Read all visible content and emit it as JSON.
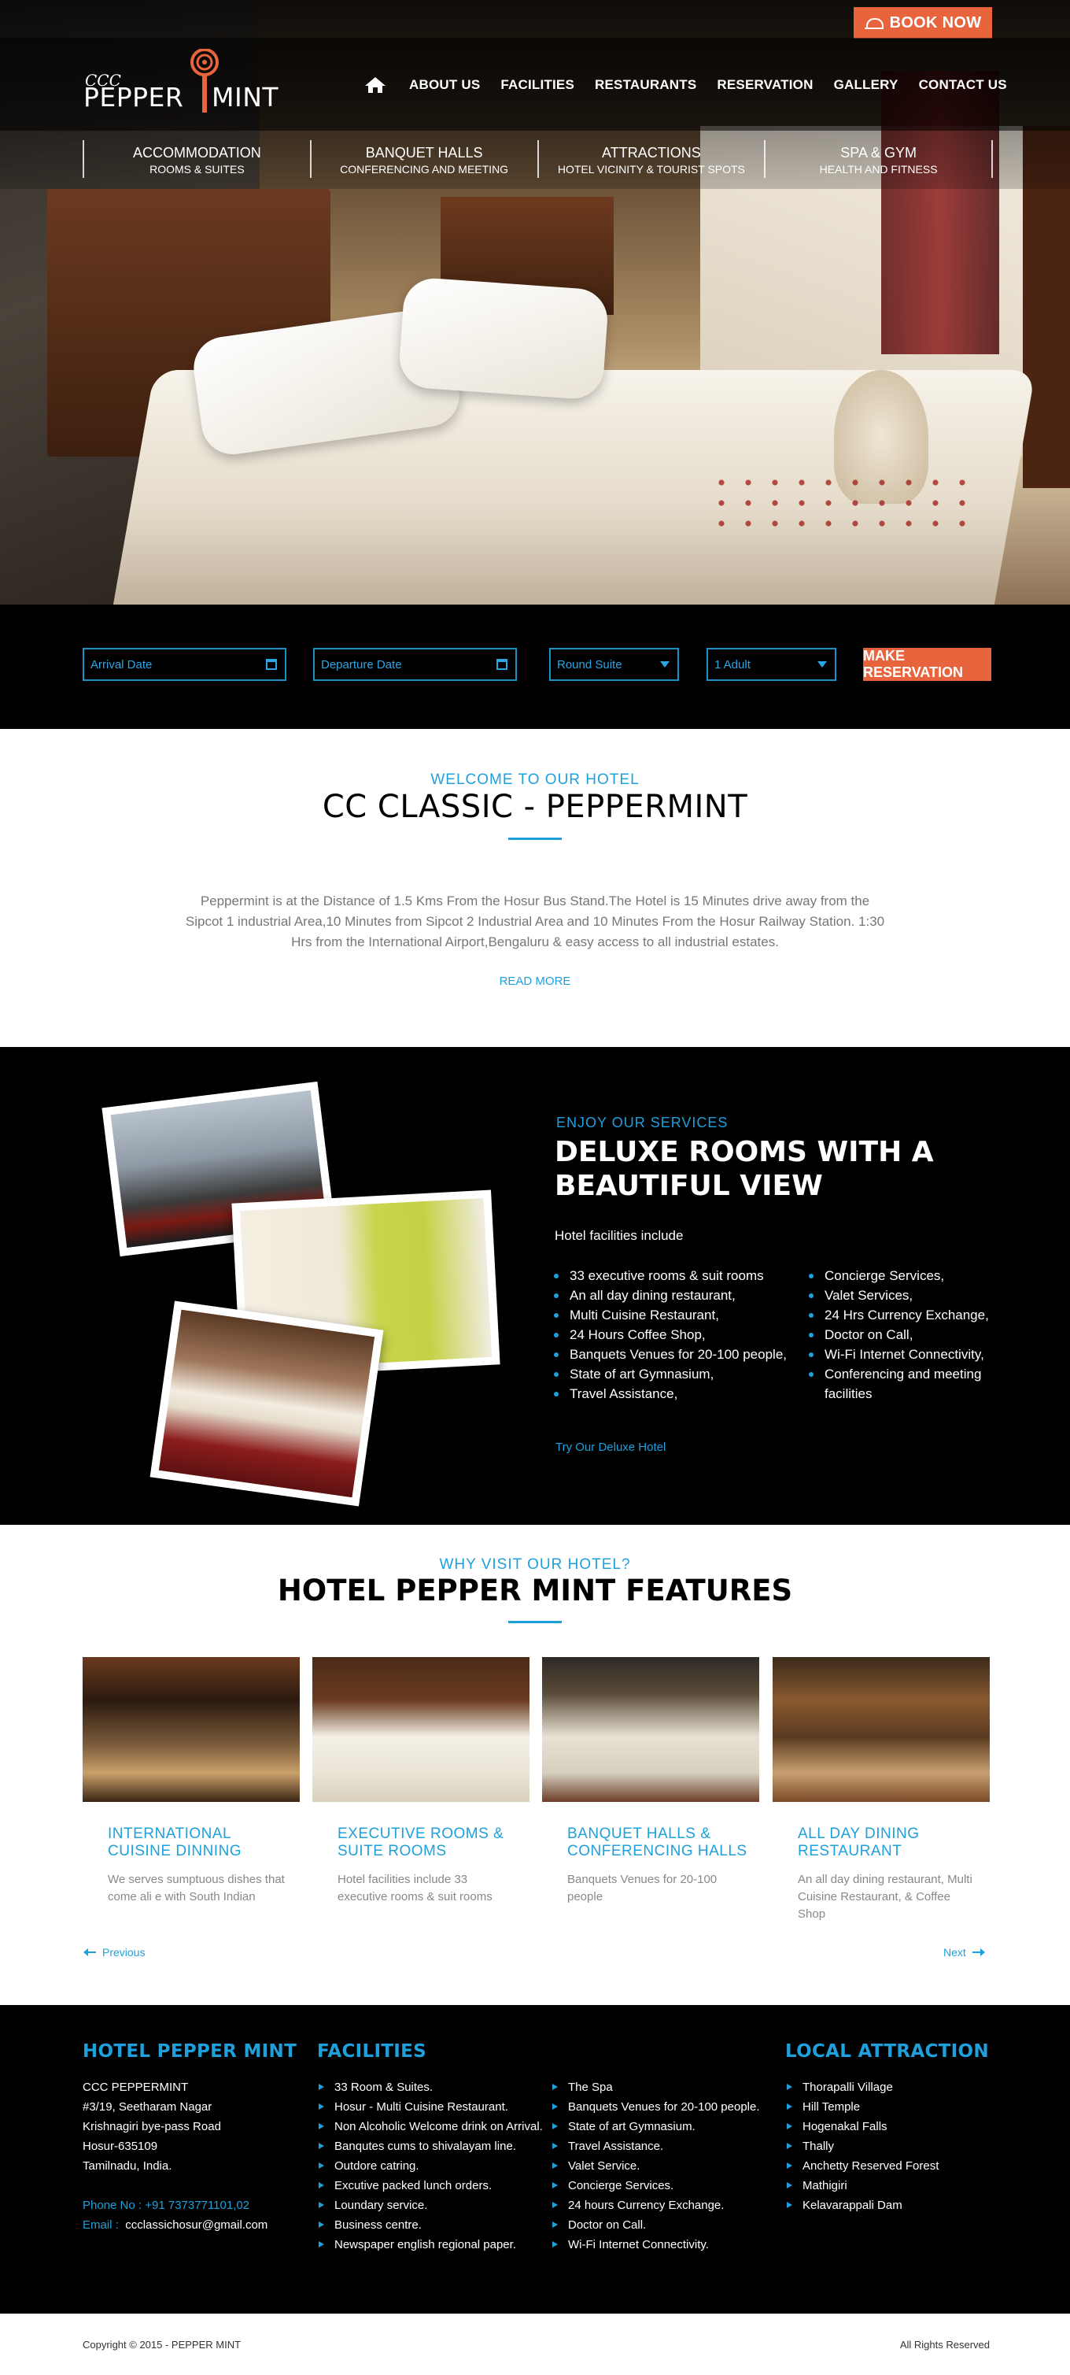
{
  "header": {
    "book_now": "BOOK NOW",
    "logo_ccc": "CCC",
    "logo_pepper": "PEPPER",
    "logo_mint": "MINT",
    "nav": [
      "ABOUT US",
      "FACILITIES",
      "RESTAURANTS",
      "RESERVATION",
      "GALLERY",
      "CONTACT US"
    ],
    "subnav": [
      {
        "title": "ACCOMMODATION",
        "sub": "ROOMS & SUITES"
      },
      {
        "title": "BANQUET HALLS",
        "sub": "CONFERENCING AND MEETING"
      },
      {
        "title": "ATTRACTIONS",
        "sub": "HOTEL VICINITY & TOURIST SPOTS"
      },
      {
        "title": "SPA & GYM",
        "sub": "HEALTH AND FITNESS"
      }
    ]
  },
  "reservation": {
    "arrival": "Arrival Date",
    "departure": "Departure Date",
    "room": "Round Suite",
    "adults": "1 Adult",
    "submit": "MAKE RESERVATION"
  },
  "welcome": {
    "eyebrow": "WELCOME TO OUR HOTEL",
    "title": "CC CLASSIC - PEPPERMINT",
    "body": "Peppermint is at the Distance of 1.5 Kms From the Hosur Bus Stand.The Hotel is 15 Minutes drive away from the Sipcot 1 industrial Area,10 Minutes from Sipcot 2 Industrial Area and 10 Minutes From the Hosur Railway Station. 1:30 Hrs from the International Airport,Bengaluru & easy access to all industrial estates.",
    "read_more": "READ MORE"
  },
  "services": {
    "eyebrow": "ENJOY OUR SERVICES",
    "title": "DELUXE ROOMS WITH A BEAUTIFUL VIEW",
    "intro": "Hotel facilities include",
    "list_left": [
      "33 executive rooms & suit rooms",
      "An all day dining restaurant,",
      "Multi Cuisine Restaurant,",
      "24 Hours Coffee Shop,",
      "Banquets Venues for 20-100 people,",
      "State of art Gymnasium,",
      "Travel Assistance,"
    ],
    "list_right": [
      "Concierge Services,",
      "Valet Services,",
      "24 Hrs Currency Exchange,",
      "Doctor on Call,",
      "Wi-Fi Internet Connectivity,",
      "Conferencing and meeting facilities"
    ],
    "link": "Try Our Deluxe Hotel"
  },
  "features": {
    "eyebrow": "WHY VISIT OUR HOTEL?",
    "title": "HOTEL PEPPER MINT FEATURES",
    "cards": [
      {
        "title": "INTERNATIONAL CUISINE DINNING",
        "desc": "We serves sumptuous dishes that come ali e with South Indian"
      },
      {
        "title": "EXECUTIVE ROOMS & SUITE ROOMS",
        "desc": "Hotel facilities include 33 executive rooms & suit rooms"
      },
      {
        "title": "BANQUET HALLS & CONFERENCING HALLS",
        "desc": "Banquets Venues for 20-100 people"
      },
      {
        "title": "ALL DAY DINING RESTAURANT",
        "desc": "An all day dining restaurant, Multi Cuisine Restaurant, & Coffee Shop"
      }
    ],
    "prev": "Previous",
    "next": "Next"
  },
  "footer": {
    "col1_title": "HOTEL PEPPER MINT",
    "address": [
      "CCC PEPPERMINT",
      "#3/19, Seetharam Nagar",
      "Krishnagiri bye-pass Road",
      "Hosur-635109",
      "Tamilnadu, India."
    ],
    "phone_label": "Phone No :",
    "phone": "+91 7373771101,02",
    "email_label": "Email :",
    "email": "ccclassichosur@gmail.com",
    "col2_title": "FACILITIES",
    "facilities_a": [
      "33 Room & Suites.",
      "Hosur - Multi Cuisine Restaurant.",
      "Non Alcoholic Welcome drink on Arrival.",
      "Banqutes cums to shivalayam line.",
      "Outdore catring.",
      "Excutive packed lunch orders.",
      "Loundary service.",
      "Business centre.",
      "Newspaper english regional paper."
    ],
    "facilities_b": [
      "The Spa",
      "Banquets Venues for 20-100 people.",
      "State of art Gymnasium.",
      "Travel Assistance.",
      "Valet Service.",
      "Concierge Services.",
      "24 hours Currency Exchange.",
      "Doctor on Call.",
      "Wi-Fi Internet Connectivity."
    ],
    "col3_title": "LOCAL  ATTRACTION",
    "attractions": [
      "Thorapalli Village",
      "Hill Temple",
      "Hogenakal Falls",
      "Thally",
      "Anchetty Reserved Forest",
      "Mathigiri",
      "Kelavarappali Dam"
    ]
  },
  "copyright": {
    "left": "Copyright © 2015 - PEPPER MINT",
    "right": "All Rights Reserved"
  },
  "colors": {
    "accent": "#1ea0dc",
    "cta": "#e8643c"
  }
}
